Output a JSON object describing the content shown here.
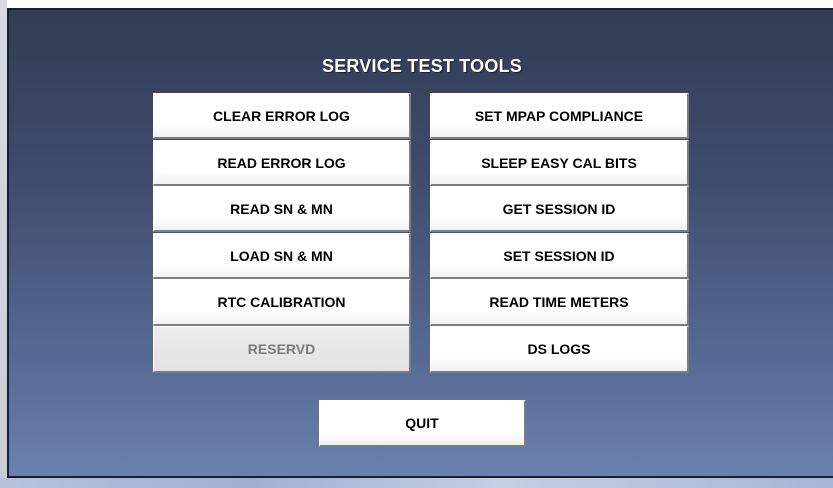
{
  "title": "SERVICE TEST TOOLS",
  "left_buttons": [
    {
      "label": "CLEAR ERROR LOG",
      "enabled": true
    },
    {
      "label": "READ ERROR LOG",
      "enabled": true
    },
    {
      "label": "READ SN & MN",
      "enabled": true
    },
    {
      "label": "LOAD SN & MN",
      "enabled": true
    },
    {
      "label": "RTC CALIBRATION",
      "enabled": true
    },
    {
      "label": "RESERVD",
      "enabled": false
    }
  ],
  "right_buttons": [
    {
      "label": "SET MPAP COMPLIANCE",
      "enabled": true
    },
    {
      "label": "SLEEP EASY CAL BITS",
      "enabled": true
    },
    {
      "label": "GET SESSION ID",
      "enabled": true
    },
    {
      "label": "SET SESSION ID",
      "enabled": true
    },
    {
      "label": "READ TIME METERS",
      "enabled": true
    },
    {
      "label": "DS LOGS",
      "enabled": true
    }
  ],
  "quit_label": "QUIT",
  "colors": {
    "panel_top": "#323c55",
    "panel_bottom": "#6a80ae",
    "button_face": "#ffffff",
    "disabled_face": "#e6e6e6",
    "disabled_text": "#7a7a7a",
    "title_text": "#ffffff"
  }
}
